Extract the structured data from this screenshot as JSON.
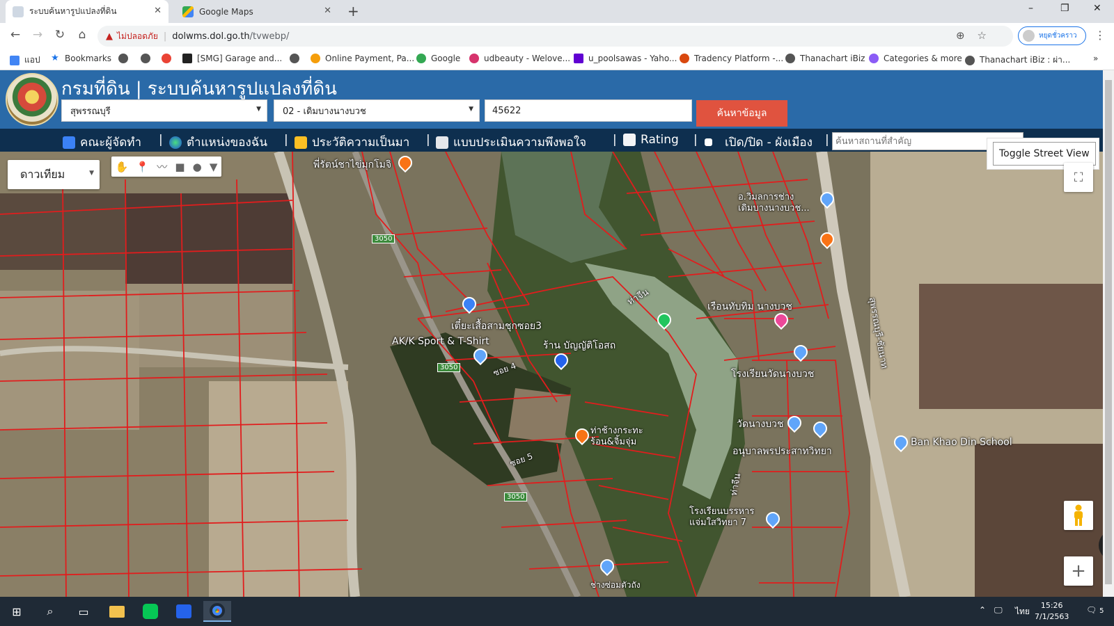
{
  "browser": {
    "tabs": [
      {
        "title": "ระบบค้นหารูปแปลงที่ดิน",
        "active": true
      },
      {
        "title": "Google Maps",
        "active": false
      }
    ],
    "new_tab": "+",
    "window_controls": [
      "–",
      "❐",
      "✕"
    ],
    "nav": {
      "back": "←",
      "forward": "→",
      "reload": "↻",
      "home": "⌂"
    },
    "omnibox": {
      "security_warning": "ไม่ปลอดภัย",
      "separator": "|",
      "host": "dolwms.dol.go.th",
      "path": "/tvwebp/"
    },
    "profile_label": "หยุดชั่วคราว",
    "bookmarks": [
      "แอป",
      "Bookmarks",
      "",
      "",
      "",
      "[SMG] Garage and...",
      "",
      "Online Payment, Pa...",
      "Google",
      "udbeauty - Welove...",
      "u_poolsawas - Yaho...",
      "Tradency Platform -...",
      "Thanachart iBiz",
      "Categories & more",
      "Thanachart iBiz : ผ่า..."
    ],
    "bookmarks_more": "»"
  },
  "site": {
    "title": "กรมที่ดิน | ระบบค้นหารูปแปลงที่ดิน",
    "province": "สุพรรณบุรี",
    "district": "02 - เดิมบางนางบวช",
    "parcel_number": "45622",
    "search_button": "ค้นหาข้อมูล",
    "menu": [
      "คณะผู้จัดทำ",
      "ตำแหน่งของฉัน",
      "ประวัติความเป็นมา",
      "แบบประเมินความพึงพอใจ",
      "Rating",
      "เปิด/ปิด - ผังเมือง"
    ],
    "menu_separator": "|",
    "place_search_placeholder": "ค้นหาสถานที่สำคัญ"
  },
  "map": {
    "map_type": "ดาวเทียม",
    "toggle_street_view": "Toggle Street View",
    "zoom_in": "+",
    "labels": [
      "พี่รัตน์ชาไข่มุกโมจิ",
      "อ.วิมลการช่าง เดิมบางนางบวช...",
      "ท่าจีน",
      "เรือนทับทิม นางบวช",
      "เตี๋ยะเสื้อสามชุกซอย3",
      "AK/K Sport & T-Shirt",
      "ร้าน บัญญัติโอสถ",
      "ซอย 4",
      "โรงเรียนวัดนางบวช",
      "สุพรรณบุรี-ชัยนาท",
      "วัดนางบวช",
      "ท่าช้างกระทะร้อน&จิ้มจุ่ม",
      "อนุบาลพรประสาทวิทยา",
      "Ban Khao Din School",
      "ซอย 5",
      "ท่าจีน",
      "โรงเรียนบรรหารแจ่มใสวิทยา 7",
      "ช่างซ่อมตัวถัง"
    ],
    "road_tags": [
      "3050",
      "3050",
      "3050"
    ],
    "colors": {
      "parcel_line": "#e11d1d",
      "header": "#2a6aa8",
      "menubar": "#0e2f4f",
      "search_button": "#e0533f"
    }
  },
  "taskbar": {
    "language": "ไทย",
    "time": "15:26",
    "date": "7/1/2563",
    "notification_count": "5"
  }
}
